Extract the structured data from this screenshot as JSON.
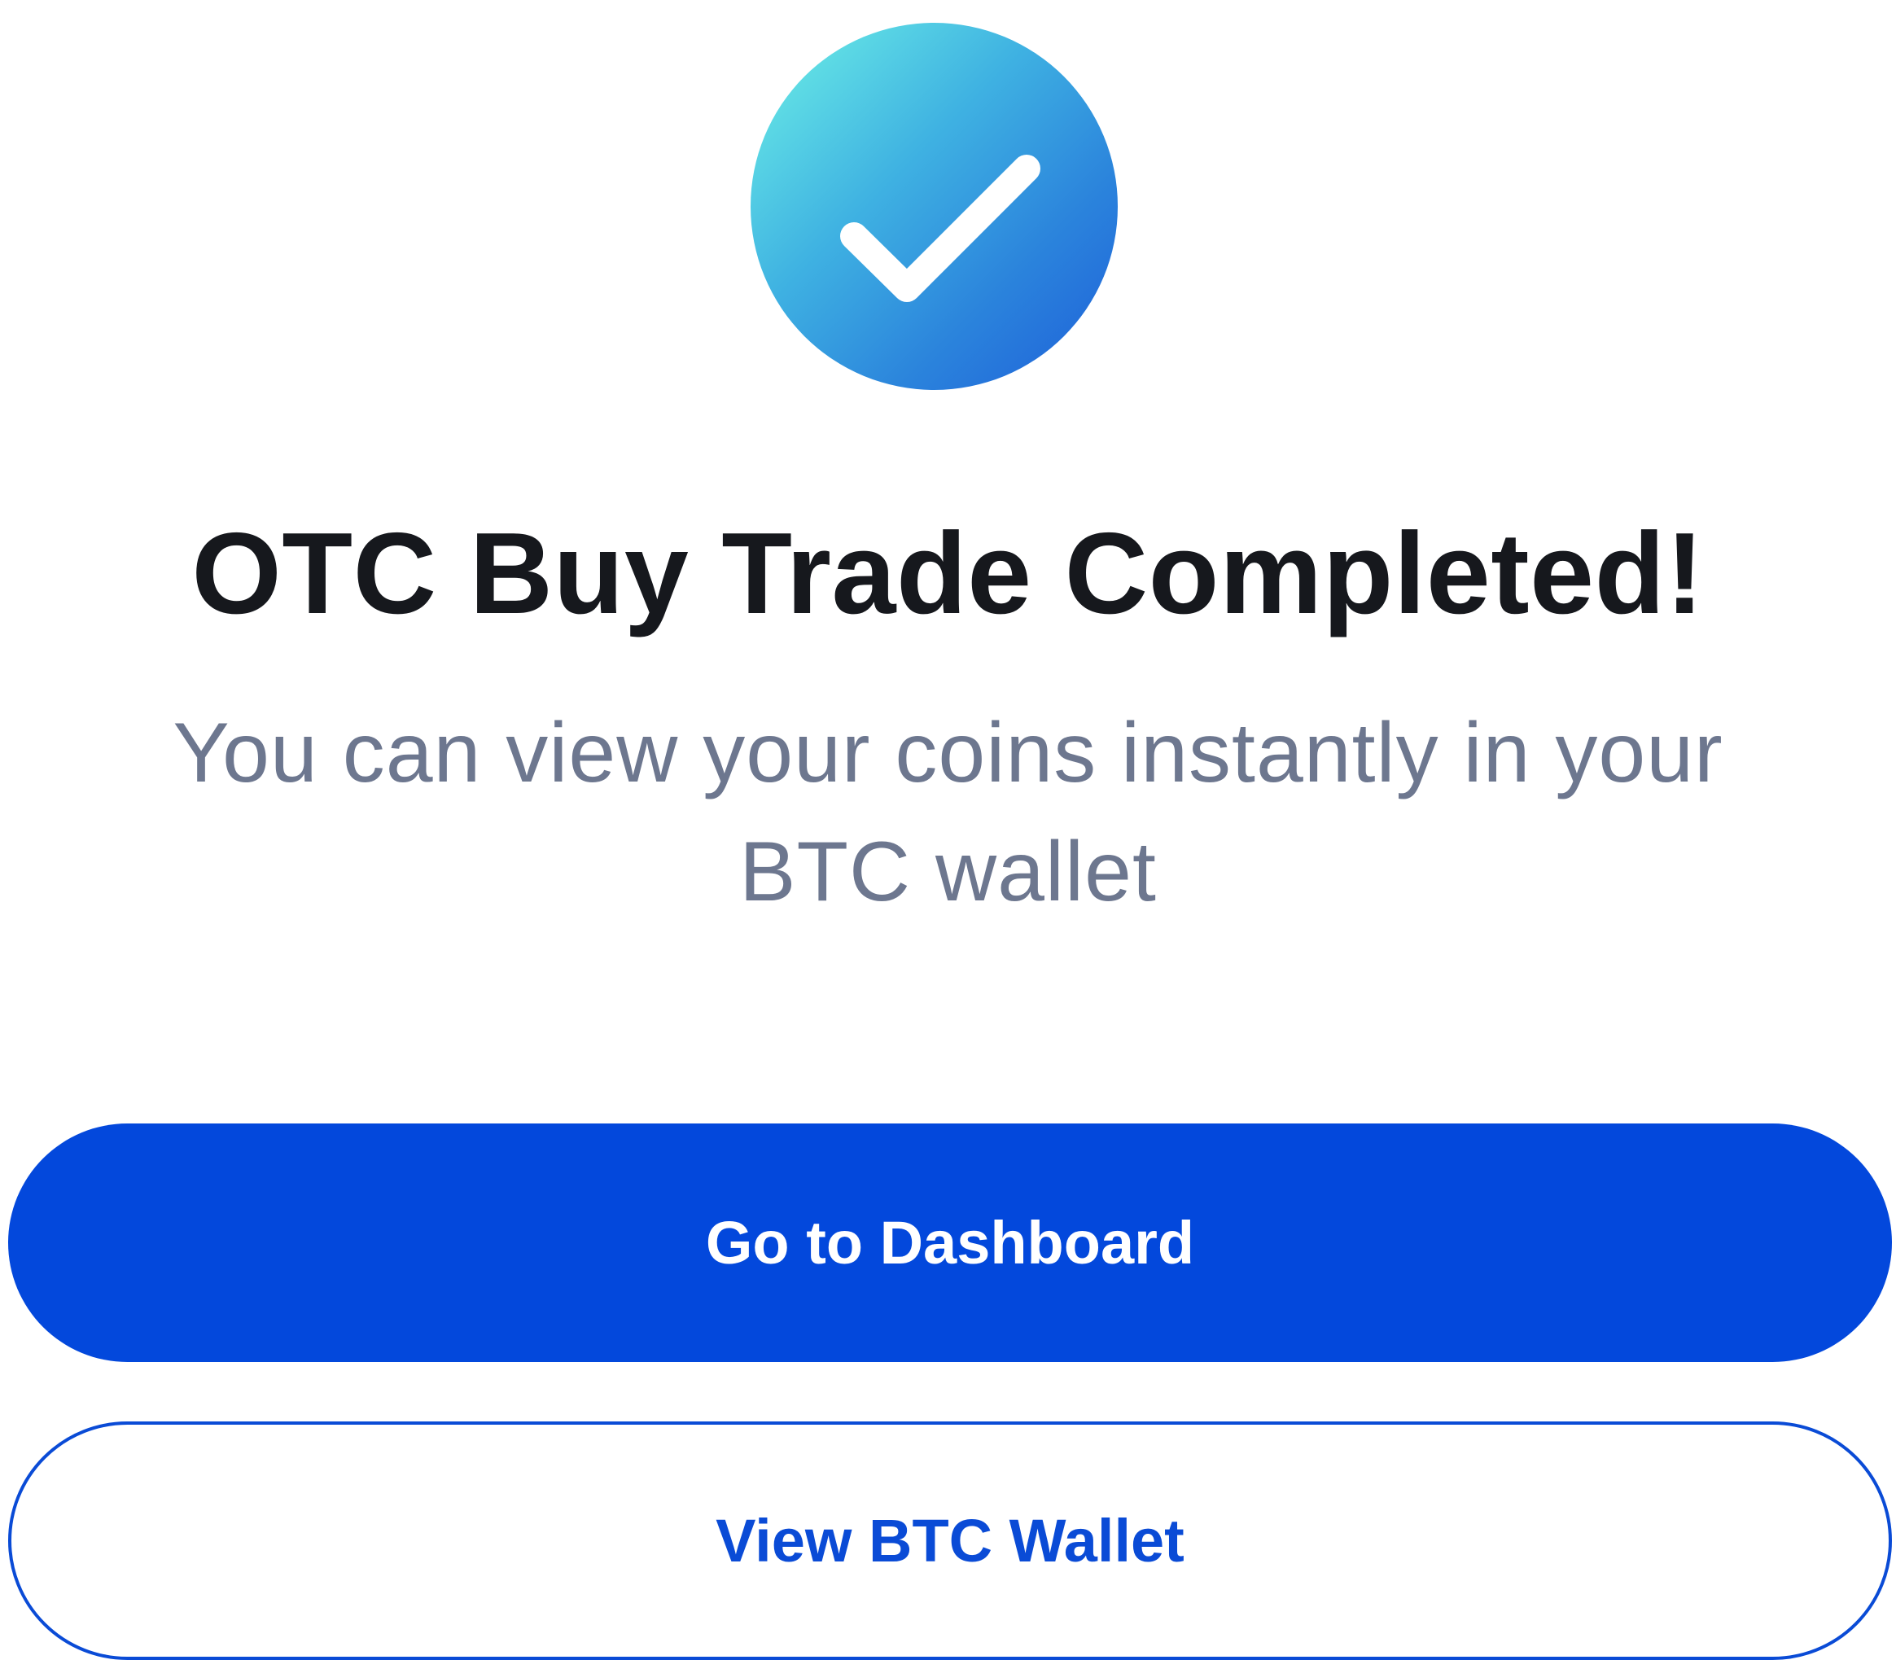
{
  "icon": {
    "name": "checkmark-icon",
    "gradient_start": "#6ff3e6",
    "gradient_end": "#1d5ed9",
    "check_color": "#ffffff"
  },
  "title": "OTC Buy Trade Completed!",
  "subtitle": "You can view your coins instantly in your BTC wallet",
  "buttons": {
    "primary_label": "Go to Dashboard",
    "secondary_label": "View BTC Wallet"
  },
  "colors": {
    "primary": "#0348dc",
    "title_text": "#16181d",
    "subtitle_text": "#6d778f",
    "background": "#ffffff"
  }
}
